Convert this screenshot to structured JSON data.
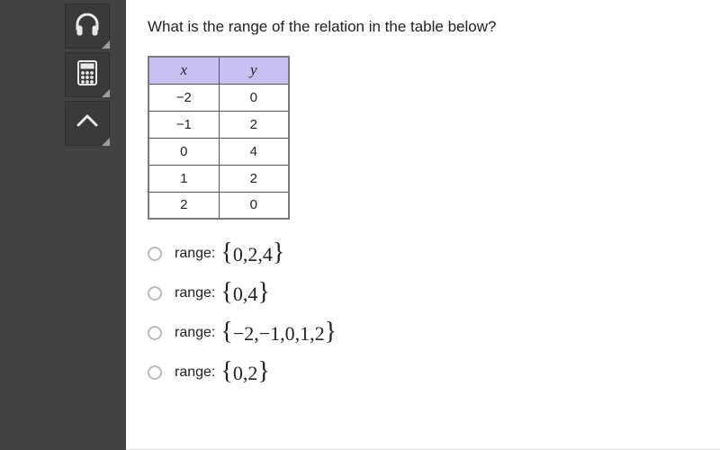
{
  "question": "What is the range of the relation in the table below?",
  "table": {
    "headers": {
      "col1": "x",
      "col2": "y"
    },
    "rows": [
      {
        "x": "−2",
        "y": "0"
      },
      {
        "x": "−1",
        "y": "2"
      },
      {
        "x": "0",
        "y": "4"
      },
      {
        "x": "1",
        "y": "2"
      },
      {
        "x": "2",
        "y": "0"
      }
    ]
  },
  "options": {
    "prefix": "range:",
    "items": [
      {
        "set": "0,2,4"
      },
      {
        "set": "0,4"
      },
      {
        "set": "−2,−1,0,1,2"
      },
      {
        "set": "0,2"
      }
    ]
  },
  "braces": {
    "open": "{",
    "close": "}"
  }
}
